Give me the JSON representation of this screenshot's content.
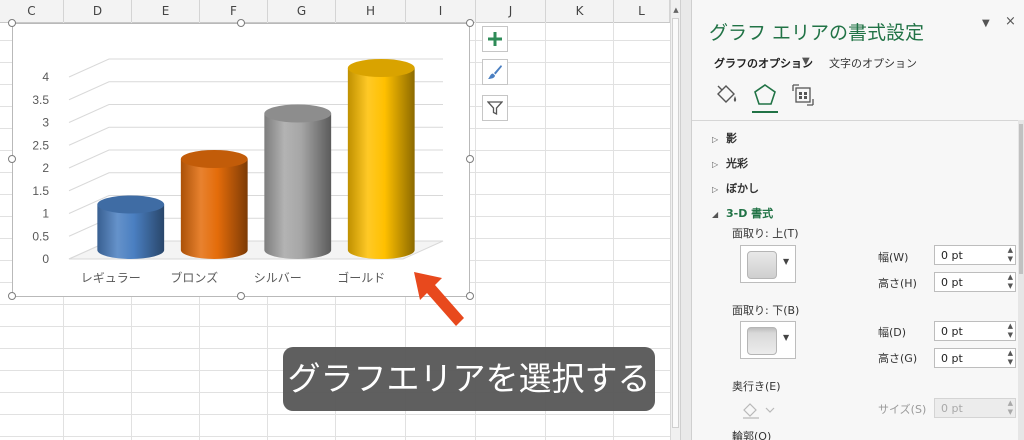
{
  "sheet": {
    "columns": [
      "C",
      "D",
      "E",
      "F",
      "G",
      "H",
      "I",
      "J",
      "K",
      "L"
    ]
  },
  "chart_data": {
    "type": "bar",
    "categories": [
      "レギュラー",
      "ブロンズ",
      "シルバー",
      "ゴールド"
    ],
    "values": [
      1.0,
      2.0,
      3.0,
      4.0
    ],
    "yticks": [
      "0",
      "0.5",
      "1",
      "1.5",
      "2",
      "2.5",
      "3",
      "3.5",
      "4"
    ],
    "ylim": [
      0,
      4
    ],
    "colors": [
      "#4a7fc1",
      "#e46c0a",
      "#a6a6a6",
      "#ffc000"
    ],
    "title": "",
    "xlabel": "",
    "ylabel": ""
  },
  "chart_buttons": [
    {
      "icon": "plus-icon"
    },
    {
      "icon": "brush-icon"
    },
    {
      "icon": "filter-icon"
    }
  ],
  "callout": {
    "text": "グラフエリアを選択する"
  },
  "pane": {
    "title": "グラフ エリアの書式設定",
    "tab_chart_options": "グラフのオプション",
    "tab_text_options": "文字のオプション",
    "sections": {
      "shadow": "影",
      "glow": "光彩",
      "soft_edges": "ぼかし",
      "format_3d": "3-D 書式"
    },
    "bevel_top_label": "面取り: 上(T)",
    "bevel_bottom_label": "面取り: 下(B)",
    "width_label": "幅(W)",
    "height_label": "高さ(H)",
    "width_label_b": "幅(D)",
    "height_label_b": "高さ(G)",
    "depth_label": "奥行き(E)",
    "size_label": "サイズ(S)",
    "contour_label": "輪郭(O)",
    "top_width": "0 pt",
    "top_height": "0 pt",
    "bottom_width": "0 pt",
    "bottom_height": "0 pt",
    "depth_size": "0 pt"
  },
  "colors": {
    "accent": "#217346"
  }
}
